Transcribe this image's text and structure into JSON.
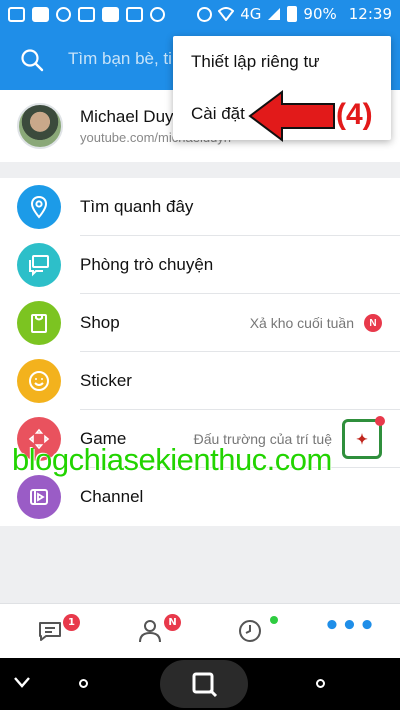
{
  "status_bar": {
    "network": "4G",
    "battery": "90%",
    "time": "12:39"
  },
  "header": {
    "search_placeholder": "Tìm bạn bè, ti"
  },
  "profile": {
    "name": "Michael Duy",
    "url": "youtube.com/michaelduyn"
  },
  "menu": {
    "items": [
      {
        "label": "Thiết lập riêng tư"
      },
      {
        "label": "Cài đặt"
      }
    ]
  },
  "annotation": {
    "label": "(4)",
    "color": "#e21a1a"
  },
  "list": {
    "items": [
      {
        "label": "Tìm quanh đây",
        "icon": "location-icon",
        "color": "#1c9be8"
      },
      {
        "label": "Phòng trò chuyện",
        "icon": "chat-rooms-icon",
        "color": "#2dbfc9"
      },
      {
        "label": "Shop",
        "icon": "shopping-bag-icon",
        "color": "#7cc421",
        "extra": "Xả kho cuối tuần",
        "badge": "N"
      },
      {
        "label": "Sticker",
        "icon": "smiley-icon",
        "color": "#f3b21d"
      },
      {
        "label": "Game",
        "icon": "gamepad-icon",
        "color": "#e9525e",
        "extra": "Đấu trường của trí tuệ"
      },
      {
        "label": "Channel",
        "icon": "channel-icon",
        "color": "#9a5cc6"
      }
    ]
  },
  "watermark": "blogchiasekienthuc.com",
  "tabbar": {
    "messages_badge": "1",
    "contacts_badge": "N",
    "timeline_dot_color": "#2ecc40",
    "more_label": "•••"
  },
  "colors": {
    "brand": "#1f8ee8",
    "badge": "#e8394b"
  }
}
